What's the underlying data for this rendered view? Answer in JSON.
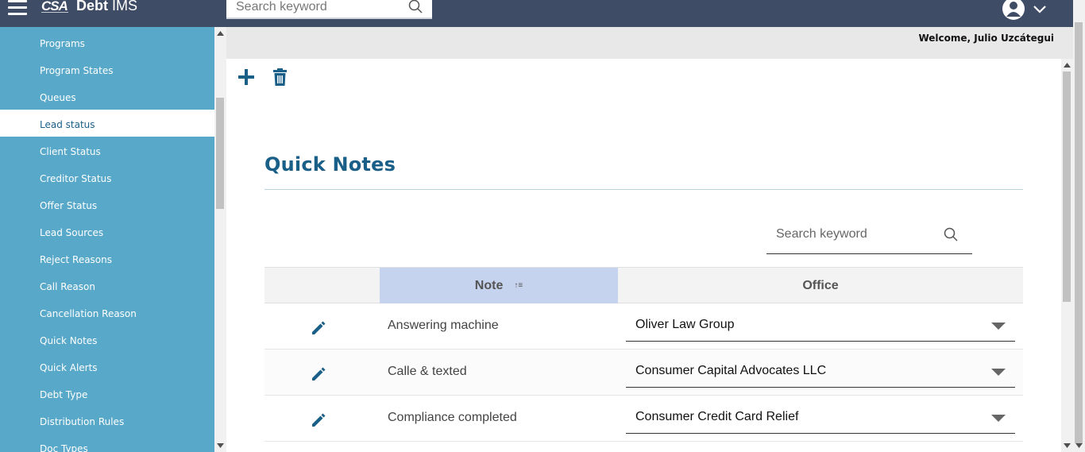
{
  "header": {
    "logo_text": "CSA",
    "app_title_bold": "Debt",
    "app_title_rest": "IMS",
    "search_placeholder": "Search keyword"
  },
  "welcome_text": "Welcome, Julio Uzcátegui",
  "sidebar": {
    "items": [
      {
        "label": "Programs",
        "active": false
      },
      {
        "label": "Program States",
        "active": false
      },
      {
        "label": "Queues",
        "active": false
      },
      {
        "label": "Lead status",
        "active": true
      },
      {
        "label": "Client Status",
        "active": false
      },
      {
        "label": "Creditor Status",
        "active": false
      },
      {
        "label": "Offer Status",
        "active": false
      },
      {
        "label": "Lead Sources",
        "active": false
      },
      {
        "label": "Reject Reasons",
        "active": false
      },
      {
        "label": "Call Reason",
        "active": false
      },
      {
        "label": "Cancellation Reason",
        "active": false
      },
      {
        "label": "Quick Notes",
        "active": false
      },
      {
        "label": "Quick Alerts",
        "active": false
      },
      {
        "label": "Debt Type",
        "active": false
      },
      {
        "label": "Distribution Rules",
        "active": false
      },
      {
        "label": "Doc Types",
        "active": false
      }
    ]
  },
  "page": {
    "title": "Quick Notes",
    "search_placeholder": "Search keyword"
  },
  "table": {
    "columns": [
      "",
      "Note",
      "Office"
    ],
    "rows": [
      {
        "note": "Answering machine",
        "office": "Oliver Law Group"
      },
      {
        "note": "Calle & texted",
        "office": "Consumer Capital Advocates LLC"
      },
      {
        "note": "Compliance completed",
        "office": "Consumer Credit Card Relief"
      }
    ]
  },
  "colors": {
    "topbar": "#3f4c66",
    "sidebar": "#58a8c9",
    "accent": "#1a5f87",
    "sorted_header": "#c6d3ee"
  },
  "icons": [
    "menu-icon",
    "search-icon",
    "user-icon",
    "chevron-down-icon",
    "plus-icon",
    "trash-icon",
    "pencil-icon",
    "sort-icon",
    "caret-down-icon"
  ]
}
